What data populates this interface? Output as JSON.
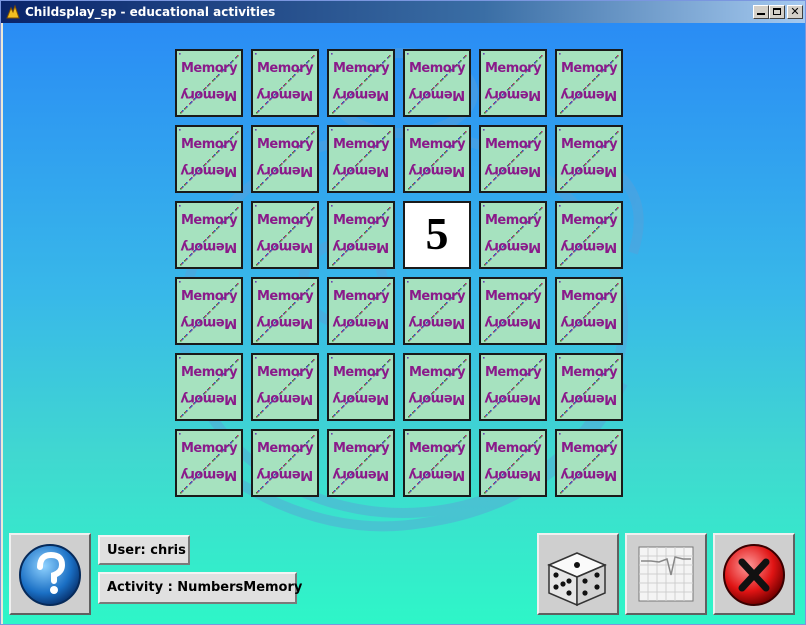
{
  "window": {
    "title": "Childsplay_sp - educational activities",
    "minimize_icon": "minimize-icon",
    "maximize_icon": "maximize-icon",
    "close_icon": "close-icon"
  },
  "board": {
    "card_back_text": "Memory",
    "revealed_card": {
      "row": 3,
      "col": 4,
      "value": "5"
    },
    "rows": 6,
    "cols": 6
  },
  "status": {
    "user": "User: chris",
    "activity": "Activity : NumbersMemory"
  },
  "buttons": {
    "help_icon": "question-mark-icon",
    "dice_icon": "dice-icon",
    "graph_icon": "graph-icon",
    "quit_icon": "x-close-icon"
  },
  "colors": {
    "card_back": "#a6e2bf",
    "card_text": "#8a1a8a",
    "bg_top": "#2a8cf5",
    "bg_bottom": "#2ef6c8"
  }
}
